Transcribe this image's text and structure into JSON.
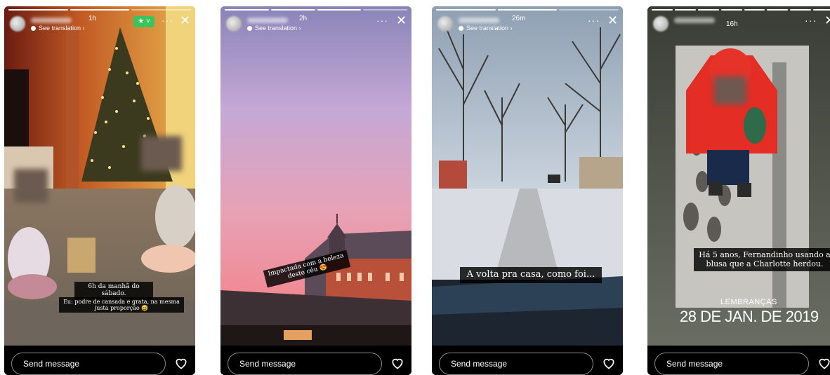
{
  "stories": [
    {
      "time": "1h",
      "translation": "See translation ›",
      "send_placeholder": "Send message",
      "caption1": "6h da manhã do sábado.",
      "caption2": "Eu: podre de cansada e grata, na mesma justa proporção 😅",
      "star": "★ ˅"
    },
    {
      "time": "2h",
      "translation": "See translation ›",
      "send_placeholder": "Send message",
      "caption1": "Impactada com a beleza deste céu 😍"
    },
    {
      "time": "26m",
      "translation": "See translation ›",
      "send_placeholder": "Send message",
      "caption1": "A volta pra casa, como foi..."
    },
    {
      "time": "16h",
      "send_placeholder": "Send message",
      "caption1": "Há 5 anos, Fernandinho usando a blusa que a Charlotte herdou.",
      "memories_label": "LEMBRANÇAS",
      "memories_date": "28 DE JAN. DE 2019"
    }
  ],
  "icons": {
    "more": "more-options-icon",
    "close": "close-icon",
    "heart": "heart-icon",
    "globe": "globe-icon",
    "star": "close-friends-star-icon"
  },
  "colors": {
    "story_bg": "#000000",
    "close_friends_green": "#3cc45a"
  }
}
